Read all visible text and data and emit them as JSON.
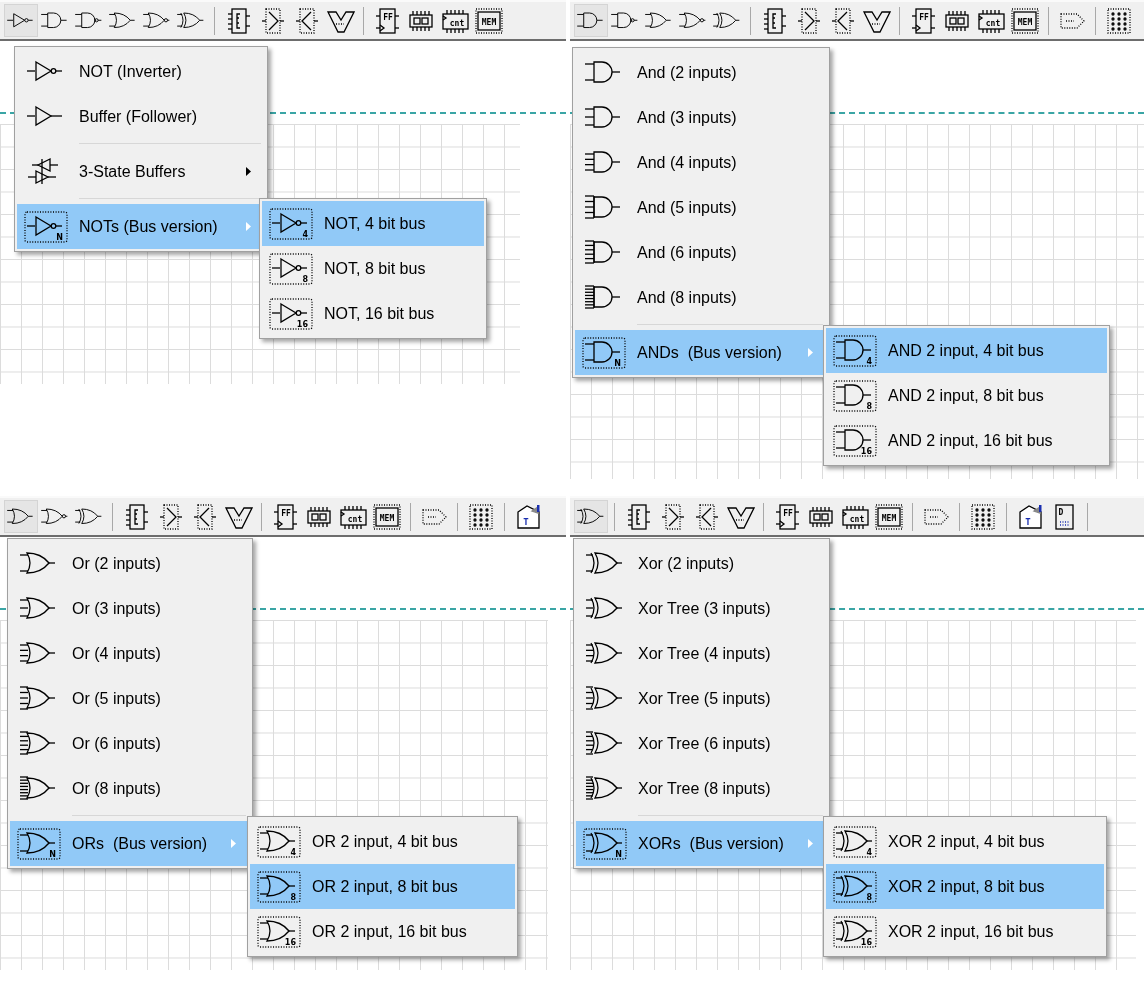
{
  "panels": [
    {
      "toolbar": [
        {
          "kind": "not",
          "selected": true
        },
        {
          "kind": "and",
          "selected": false
        },
        {
          "kind": "nand",
          "selected": false
        },
        {
          "kind": "or",
          "selected": false
        },
        {
          "kind": "nor",
          "selected": false
        },
        {
          "kind": "xor",
          "selected": false
        },
        {
          "kind": "sep"
        },
        {
          "kind": "encoder",
          "selected": false
        },
        {
          "kind": "mux",
          "selected": false
        },
        {
          "kind": "demux",
          "selected": false
        },
        {
          "kind": "vshape",
          "selected": false
        },
        {
          "kind": "sep"
        },
        {
          "kind": "flipflop",
          "label": "FF",
          "selected": false
        },
        {
          "kind": "register",
          "selected": false
        },
        {
          "kind": "counter",
          "label": "cnt",
          "selected": false
        },
        {
          "kind": "memory",
          "label": "MEM",
          "selected": false
        }
      ],
      "menu": [
        {
          "kind": "not",
          "label": "NOT (Inverter)",
          "submenu": false,
          "selected": false
        },
        {
          "kind": "buf",
          "label": "Buffer (Follower)",
          "submenu": false,
          "selected": false
        },
        {
          "kind": "separator"
        },
        {
          "kind": "tri",
          "label": "3-State Buffers",
          "submenu": true,
          "selected": false
        },
        {
          "kind": "separator"
        },
        {
          "kind": "not",
          "badge": "N",
          "label": "NOTs (Bus version)",
          "submenu": true,
          "selected": true
        }
      ],
      "submenu": [
        {
          "kind": "not",
          "badge": "4",
          "label": "NOT, 4 bit bus",
          "submenu": false,
          "selected": true
        },
        {
          "kind": "not",
          "badge": "8",
          "label": "NOT, 8 bit bus",
          "submenu": false,
          "selected": false
        },
        {
          "kind": "not",
          "badge": "16",
          "label": "NOT, 16 bit bus",
          "submenu": false,
          "selected": false
        }
      ]
    },
    {
      "toolbar": [
        {
          "kind": "and",
          "selected": true
        },
        {
          "kind": "nand",
          "selected": false
        },
        {
          "kind": "or",
          "selected": false
        },
        {
          "kind": "nor",
          "selected": false
        },
        {
          "kind": "xor",
          "selected": false
        },
        {
          "kind": "sep"
        },
        {
          "kind": "encoder",
          "selected": false
        },
        {
          "kind": "mux",
          "selected": false
        },
        {
          "kind": "demux",
          "selected": false
        },
        {
          "kind": "vshape",
          "selected": false
        },
        {
          "kind": "sep"
        },
        {
          "kind": "flipflop",
          "label": "FF",
          "selected": false
        },
        {
          "kind": "register",
          "selected": false
        },
        {
          "kind": "counter",
          "label": "cnt",
          "selected": false
        },
        {
          "kind": "memory",
          "label": "MEM",
          "selected": false
        },
        {
          "kind": "sep"
        },
        {
          "kind": "probe",
          "selected": false
        },
        {
          "kind": "sep"
        },
        {
          "kind": "matrix",
          "selected": false
        }
      ],
      "menu": [
        {
          "kind": "and",
          "label": "And (2 inputs)",
          "submenu": false,
          "selected": false
        },
        {
          "kind": "and",
          "label": "And (3 inputs)",
          "submenu": false,
          "selected": false
        },
        {
          "kind": "and",
          "label": "And (4 inputs)",
          "submenu": false,
          "selected": false
        },
        {
          "kind": "and",
          "label": "And (5 inputs)",
          "submenu": false,
          "selected": false
        },
        {
          "kind": "and",
          "label": "And (6 inputs)",
          "submenu": false,
          "selected": false
        },
        {
          "kind": "and",
          "label": "And (8 inputs)",
          "submenu": false,
          "selected": false
        },
        {
          "kind": "separator"
        },
        {
          "kind": "and",
          "badge": "N",
          "label": "ANDs  (Bus version)",
          "submenu": true,
          "selected": true
        }
      ],
      "submenu": [
        {
          "kind": "and",
          "badge": "4",
          "label": "AND 2 input, 4 bit bus",
          "submenu": false,
          "selected": true
        },
        {
          "kind": "and",
          "badge": "8",
          "label": "AND 2 input, 8 bit bus",
          "submenu": false,
          "selected": false
        },
        {
          "kind": "and",
          "badge": "16",
          "label": "AND 2 input, 16 bit bus",
          "submenu": false,
          "selected": false
        }
      ]
    },
    {
      "toolbar": [
        {
          "kind": "or",
          "selected": true
        },
        {
          "kind": "nor",
          "selected": false
        },
        {
          "kind": "xor",
          "selected": false
        },
        {
          "kind": "sep"
        },
        {
          "kind": "encoder",
          "selected": false
        },
        {
          "kind": "mux",
          "selected": false
        },
        {
          "kind": "demux",
          "selected": false
        },
        {
          "kind": "vshape",
          "selected": false
        },
        {
          "kind": "sep"
        },
        {
          "kind": "flipflop",
          "label": "FF",
          "selected": false
        },
        {
          "kind": "register",
          "selected": false
        },
        {
          "kind": "counter",
          "label": "cnt",
          "selected": false
        },
        {
          "kind": "memory",
          "label": "MEM",
          "selected": false
        },
        {
          "kind": "sep"
        },
        {
          "kind": "probe",
          "selected": false
        },
        {
          "kind": "sep"
        },
        {
          "kind": "matrix",
          "selected": false
        },
        {
          "kind": "sep"
        },
        {
          "kind": "texttool",
          "label": "T",
          "selected": false
        }
      ],
      "menu": [
        {
          "kind": "or",
          "label": "Or (2 inputs)",
          "submenu": false,
          "selected": false
        },
        {
          "kind": "or",
          "label": "Or (3 inputs)",
          "submenu": false,
          "selected": false
        },
        {
          "kind": "or",
          "label": "Or (4 inputs)",
          "submenu": false,
          "selected": false
        },
        {
          "kind": "or",
          "label": "Or (5 inputs)",
          "submenu": false,
          "selected": false
        },
        {
          "kind": "or",
          "label": "Or (6 inputs)",
          "submenu": false,
          "selected": false
        },
        {
          "kind": "or",
          "label": "Or (8 inputs)",
          "submenu": false,
          "selected": false
        },
        {
          "kind": "separator"
        },
        {
          "kind": "or",
          "badge": "N",
          "label": "ORs  (Bus version)",
          "submenu": true,
          "selected": true
        }
      ],
      "submenu": [
        {
          "kind": "or",
          "badge": "4",
          "label": "OR 2 input, 4 bit bus",
          "submenu": false,
          "selected": false
        },
        {
          "kind": "or",
          "badge": "8",
          "label": "OR 2 input, 8 bit bus",
          "submenu": false,
          "selected": true
        },
        {
          "kind": "or",
          "badge": "16",
          "label": "OR 2 input, 16 bit bus",
          "submenu": false,
          "selected": false
        }
      ]
    },
    {
      "toolbar": [
        {
          "kind": "xor",
          "selected": true
        },
        {
          "kind": "sep"
        },
        {
          "kind": "encoder",
          "selected": false
        },
        {
          "kind": "mux",
          "selected": false
        },
        {
          "kind": "demux",
          "selected": false
        },
        {
          "kind": "vshape",
          "selected": false
        },
        {
          "kind": "sep"
        },
        {
          "kind": "flipflop",
          "label": "FF",
          "selected": false
        },
        {
          "kind": "register",
          "selected": false
        },
        {
          "kind": "counter",
          "label": "cnt",
          "selected": false
        },
        {
          "kind": "memory",
          "label": "MEM",
          "selected": false
        },
        {
          "kind": "sep"
        },
        {
          "kind": "probe",
          "selected": false
        },
        {
          "kind": "sep"
        },
        {
          "kind": "matrix",
          "selected": false
        },
        {
          "kind": "sep"
        },
        {
          "kind": "texttool",
          "label": "T",
          "selected": false
        },
        {
          "kind": "dchip",
          "label": "D",
          "selected": false
        },
        {
          "kind": "sep"
        }
      ],
      "menu": [
        {
          "kind": "xor",
          "label": "Xor (2 inputs)",
          "submenu": false,
          "selected": false
        },
        {
          "kind": "xor",
          "label": "Xor Tree (3 inputs)",
          "submenu": false,
          "selected": false
        },
        {
          "kind": "xor",
          "label": "Xor Tree (4 inputs)",
          "submenu": false,
          "selected": false
        },
        {
          "kind": "xor",
          "label": "Xor Tree (5 inputs)",
          "submenu": false,
          "selected": false
        },
        {
          "kind": "xor",
          "label": "Xor Tree (6 inputs)",
          "submenu": false,
          "selected": false
        },
        {
          "kind": "xor",
          "label": "Xor Tree (8 inputs)",
          "submenu": false,
          "selected": false
        },
        {
          "kind": "separator"
        },
        {
          "kind": "xor",
          "badge": "N",
          "label": "XORs  (Bus version)",
          "submenu": true,
          "selected": true
        }
      ],
      "submenu": [
        {
          "kind": "xor",
          "badge": "4",
          "label": "XOR 2 input, 4 bit bus",
          "submenu": false,
          "selected": false
        },
        {
          "kind": "xor",
          "badge": "8",
          "label": "XOR 2 input, 8 bit bus",
          "submenu": false,
          "selected": true
        },
        {
          "kind": "xor",
          "badge": "16",
          "label": "XOR 2 input, 16 bit bus",
          "submenu": false,
          "selected": false
        }
      ]
    }
  ]
}
